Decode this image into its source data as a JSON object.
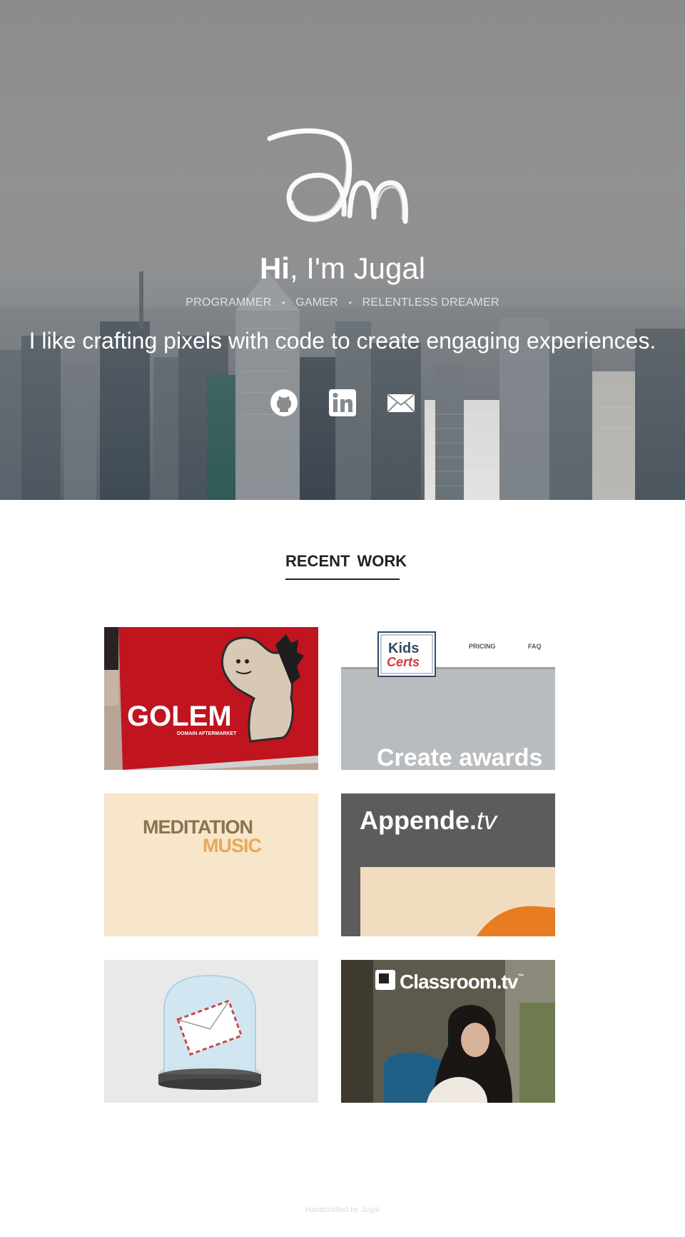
{
  "hero": {
    "logo_alt": "jm",
    "greeting_bold": "Hi",
    "greeting_rest": ", I'm Jugal",
    "roles": [
      "PROGRAMMER",
      "GAMER",
      "RELENTLESS DREAMER"
    ],
    "role_separator": "•",
    "tagline": "I like crafting pixels with code to create engaging experiences.",
    "socials": [
      {
        "icon": "github-icon"
      },
      {
        "icon": "linkedin-icon"
      },
      {
        "icon": "mail-icon"
      }
    ]
  },
  "recent_work": {
    "title_bold": "RECENT",
    "title_rest": "WORK",
    "items": [
      {
        "name": "golem",
        "label": "GOLEM",
        "sublabel": "DOMAIN AFTERMARKET",
        "colors": {
          "bg": "#c0141f"
        }
      },
      {
        "name": "kids-certs",
        "label_top": "Kids",
        "label_bottom": "Certs",
        "nav": [
          "PRICING",
          "FAQ"
        ],
        "headline": "Create awards"
      },
      {
        "name": "meditation-music",
        "label_top": "MEDITATION",
        "label_bottom": "MUSIC"
      },
      {
        "name": "appende-tv",
        "label": "Appende.",
        "label_italic": "tv"
      },
      {
        "name": "snow-globe-mail"
      },
      {
        "name": "classroom-tv",
        "label": "Classroom.tv",
        "label_tm": "™"
      }
    ]
  },
  "footer": {
    "text": "Handcrafted by Jugal"
  }
}
